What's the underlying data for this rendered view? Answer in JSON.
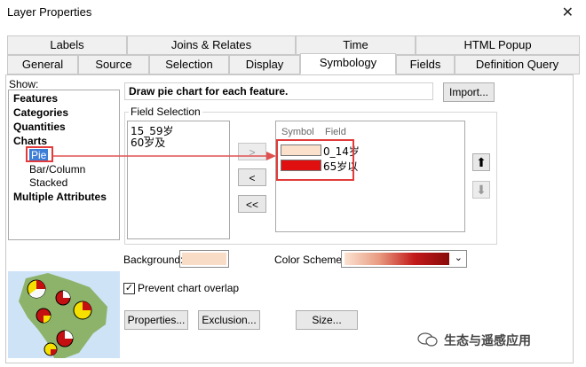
{
  "window": {
    "title": "Layer Properties",
    "close_icon": "close-icon"
  },
  "tabs_top": [
    "Labels",
    "Joins & Relates",
    "Time",
    "HTML Popup"
  ],
  "tabs_bottom": [
    "General",
    "Source",
    "Selection",
    "Display",
    "Symbology",
    "Fields",
    "Definition Query"
  ],
  "active_tab": "Symbology",
  "show": {
    "label": "Show:",
    "items": [
      "Features",
      "Categories",
      "Quantities",
      "Charts"
    ],
    "chart_items": [
      "Pie",
      "Bar/Column",
      "Stacked"
    ],
    "selected": "Pie",
    "last_item": "Multiple Attributes"
  },
  "description": "Draw pie chart for each feature.",
  "import_label": "Import...",
  "field_selection": {
    "label": "Field Selection",
    "fields": [
      "15_59岁",
      "60岁及"
    ]
  },
  "move_buttons": {
    "add_one": ">",
    "remove_one": "<",
    "remove_all": "<<"
  },
  "selected_fields": {
    "col_symbol": "Symbol",
    "col_field": "Field",
    "rows": [
      {
        "label": "0_14岁",
        "color": "#fbe0cc"
      },
      {
        "label": "65岁以",
        "color": "#e01010"
      }
    ]
  },
  "background_label": "Background:",
  "background_color": "#f8dcc6",
  "color_scheme_label": "Color Scheme:",
  "prevent_overlap_label": "Prevent chart overlap",
  "buttons": {
    "properties": "Properties...",
    "exclusion": "Exclusion...",
    "size": "Size..."
  },
  "watermark": "生态与遥感应用",
  "colors": {
    "accent_red": "#e23b3b",
    "arrow_red": "#e05050"
  }
}
